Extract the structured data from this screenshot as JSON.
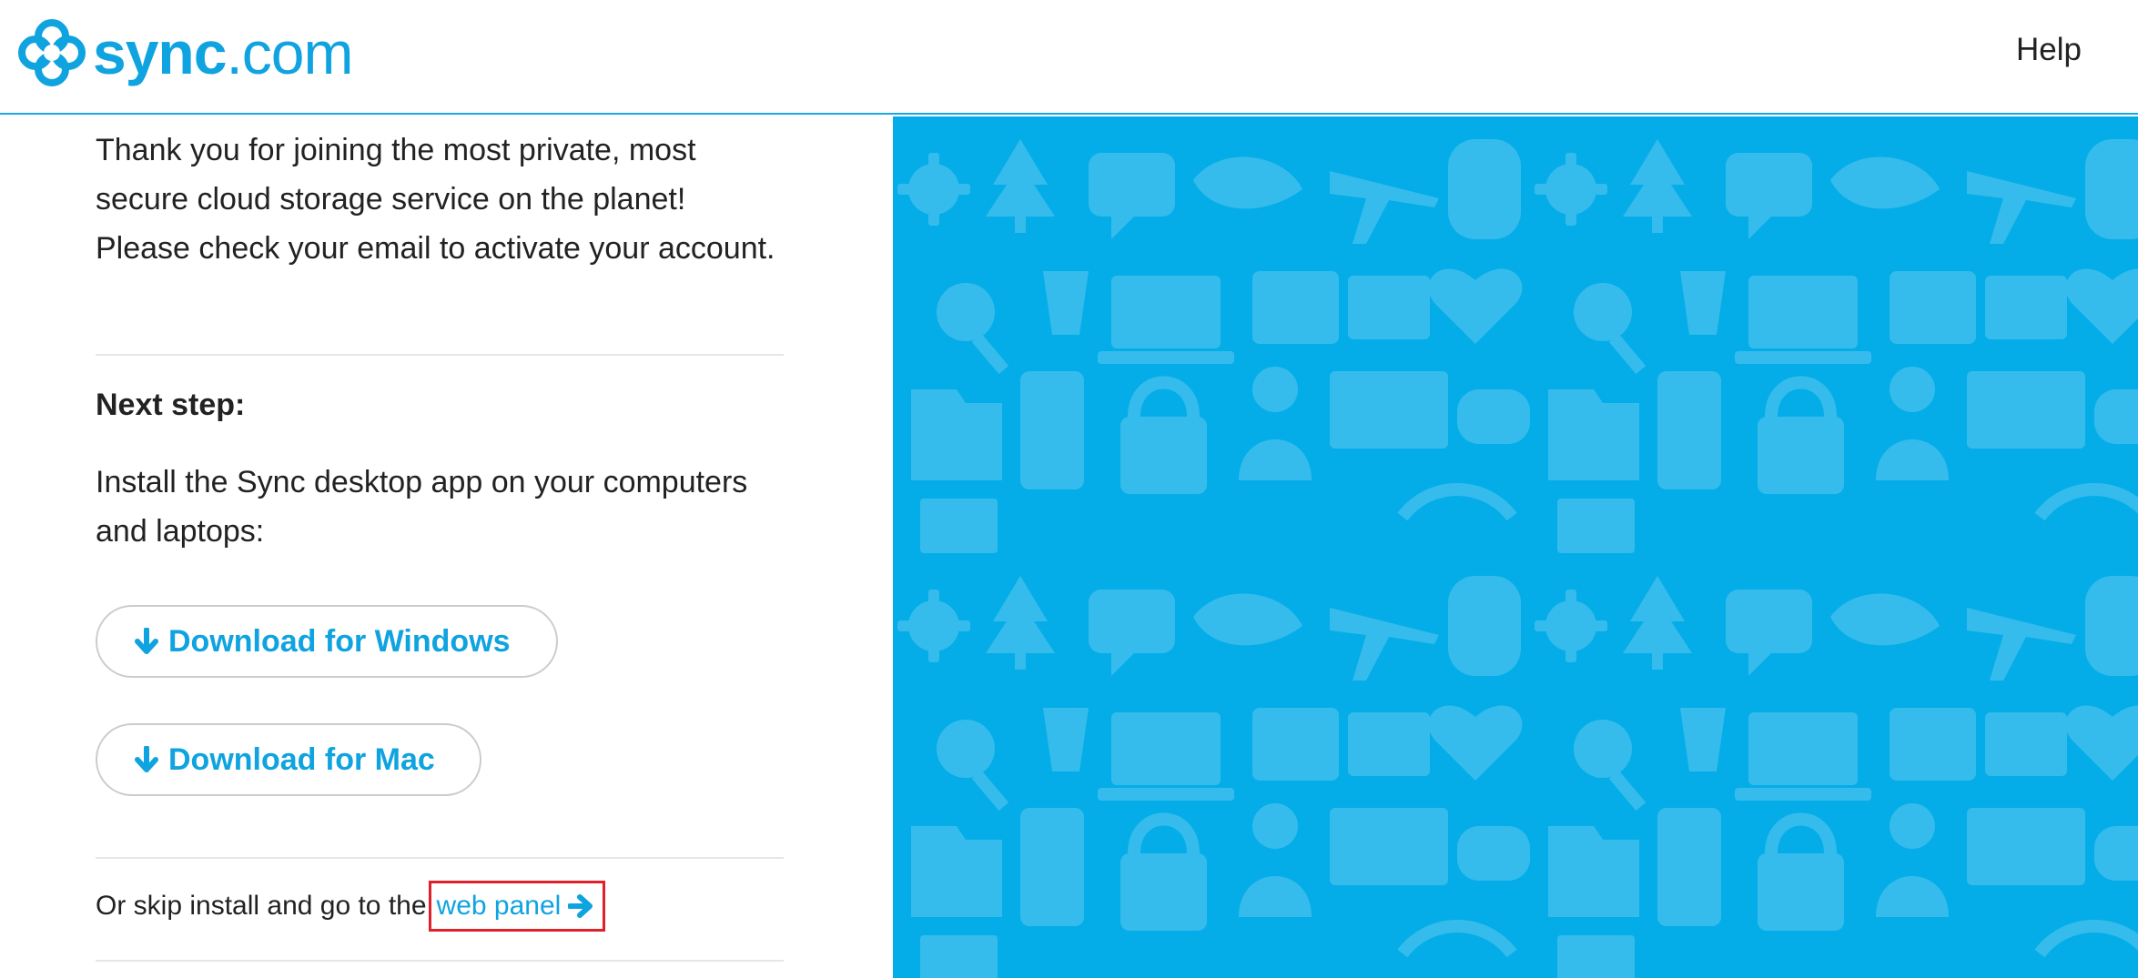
{
  "header": {
    "logo_bold": "sync",
    "logo_light": ".com",
    "help_label": "Help"
  },
  "main": {
    "intro_text": "Thank you for joining the most private, most secure cloud storage service on the planet! Please check your email to activate your account.",
    "next_step_heading": "Next step:",
    "install_text": "Install the Sync desktop app on your computers and laptops:",
    "download_windows_label": "Download for Windows",
    "download_mac_label": "Download for Mac",
    "skip_text": "Or skip install and go to the",
    "web_panel_label": "web panel"
  },
  "colors": {
    "brand_blue": "#0fa3df",
    "panel_background": "#04ade8",
    "highlight_box": "#e0202a"
  },
  "icons": [
    "sync-logo-icon",
    "arrow-down-icon",
    "arrow-right-icon"
  ]
}
